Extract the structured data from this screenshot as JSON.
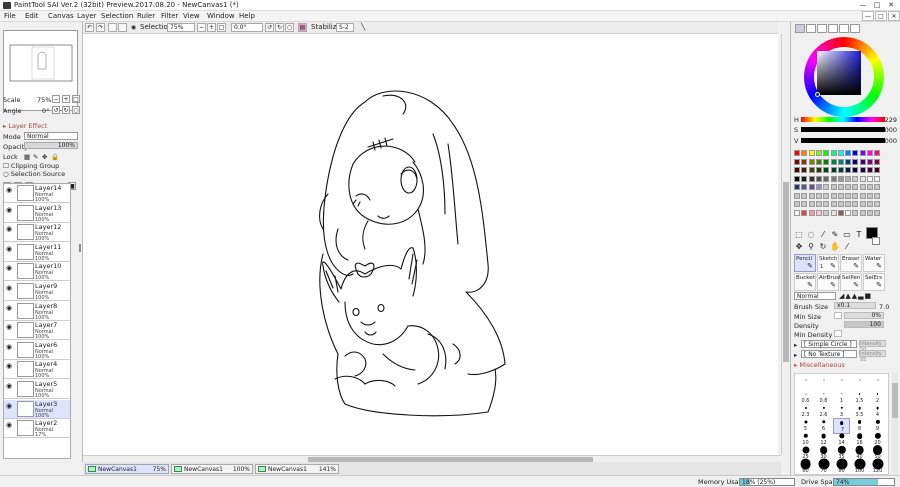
{
  "window": {
    "title": "PaintTool SAI Ver.2 (32bit) Preview.2017.08.20 - NewCanvas1 (*)",
    "min": "—",
    "max": "□",
    "close": "✕"
  },
  "menu": [
    "File",
    "Edit",
    "Canvas",
    "Layer",
    "Selection",
    "Ruler",
    "Filter",
    "View",
    "Window",
    "Help"
  ],
  "toolbar": {
    "selection_label": "Selection",
    "zoom": "75%",
    "angle": "0.0°",
    "stabilizer_label": "Stabilizer",
    "stabilizer_value": "S-2"
  },
  "navigator": {
    "scale_label": "Scale",
    "scale_value": "75%",
    "angle_label": "Angle",
    "angle_value": "0°"
  },
  "layer_effect": {
    "header": "Layer Effect",
    "mode_label": "Mode",
    "mode_value": "Normal",
    "opacity_label": "Opacity",
    "opacity_value": "100%",
    "lock_label": "Lock",
    "clipping_label": "Clipping Group",
    "selection_source_label": "Selection Source"
  },
  "layers": [
    {
      "name": "Layer14",
      "blend": "Normal",
      "opacity": "100%"
    },
    {
      "name": "Layer13",
      "blend": "Normal",
      "opacity": "100%"
    },
    {
      "name": "Layer12",
      "blend": "Normal",
      "opacity": "100%"
    },
    {
      "name": "Layer11",
      "blend": "Normal",
      "opacity": "100%"
    },
    {
      "name": "Layer10",
      "blend": "Normal",
      "opacity": "100%"
    },
    {
      "name": "Layer9",
      "blend": "Normal",
      "opacity": "100%"
    },
    {
      "name": "Layer8",
      "blend": "Normal",
      "opacity": "100%"
    },
    {
      "name": "Layer7",
      "blend": "Normal",
      "opacity": "100%"
    },
    {
      "name": "Layer6",
      "blend": "Normal",
      "opacity": "100%"
    },
    {
      "name": "Layer4",
      "blend": "Normal",
      "opacity": "100%"
    },
    {
      "name": "Layer5",
      "blend": "Normal",
      "opacity": "100%"
    },
    {
      "name": "Layer3",
      "blend": "Normal",
      "opacity": "100%",
      "selected": true
    },
    {
      "name": "Layer2",
      "blend": "Normal",
      "opacity": "17%"
    }
  ],
  "canvas_tabs": [
    {
      "name": "NewCanvas1",
      "zoom": "75%",
      "selected": true
    },
    {
      "name": "NewCanvas1",
      "zoom": "100%"
    },
    {
      "name": "NewCanvas1",
      "zoom": "141%"
    }
  ],
  "status": {
    "memory_label": "Memory Usage",
    "memory_value": "18% (25%)",
    "memory_fraction": 0.18,
    "drive_label": "Drive Space",
    "drive_value": "74%",
    "drive_fraction": 0.74
  },
  "color": {
    "h_label": "H",
    "h_value": "229",
    "s_label": "S",
    "s_value": "000",
    "v_label": "V",
    "v_value": "000",
    "current": "#000000"
  },
  "brush_tools": [
    {
      "name": "Pencil",
      "selected": true
    },
    {
      "name": "Sketch",
      "sub": "1"
    },
    {
      "name": "Eraser"
    },
    {
      "name": "Water"
    },
    {
      "name": "Bucket"
    },
    {
      "name": "AirBrush"
    },
    {
      "name": "SelPen"
    },
    {
      "name": "SelErs"
    }
  ],
  "brush_props": {
    "mode_value": "Normal",
    "size_label": "Brush Size",
    "size_mult": "x0.1",
    "size_value": "7.0",
    "minsize_label": "Min Size",
    "minsize_value": "0%",
    "density_label": "Density",
    "density_value": "100",
    "mindensity_label": "Min Density",
    "shape_value": "[ Simple Circle ]",
    "shape_intensity": "Intensity 50",
    "texture_value": "[ No Texture ]",
    "texture_intensity": "Intensity 95",
    "misc_label": "Miscellaneous"
  },
  "brush_sizes": [
    "",
    "",
    "",
    "",
    "",
    "0.6",
    "0.8",
    "1",
    "1.5",
    "2",
    "2.3",
    "2.6",
    "3",
    "3.5",
    "4",
    "5",
    "6",
    "7",
    "8",
    "9",
    "10",
    "12",
    "14",
    "16",
    "20",
    "25",
    "30",
    "35",
    "40",
    "50",
    "60",
    "70",
    "80",
    "100",
    "120"
  ]
}
